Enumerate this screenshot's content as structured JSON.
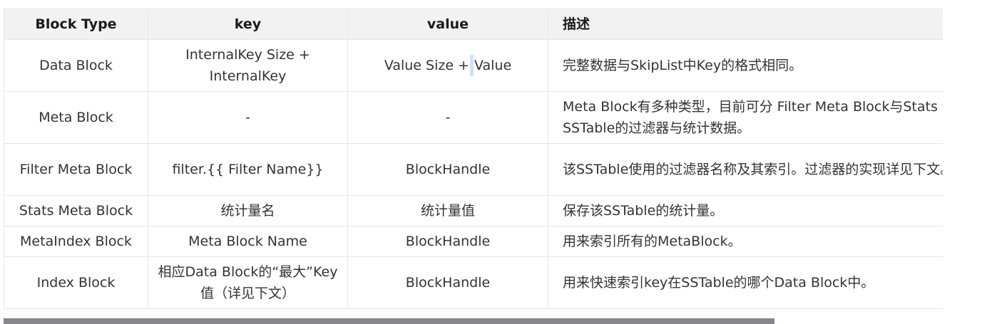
{
  "table": {
    "headers": [
      "Block Type",
      "key",
      "value",
      "描述"
    ],
    "rows": [
      {
        "type": "Data Block",
        "key": "InternalKey Size + InternalKey",
        "value_a": "Value Size +",
        "value_b": "Value",
        "desc": "完整数据与SkipList中Key的格式相同。"
      },
      {
        "type": "Meta Block",
        "key": "-",
        "value": "-",
        "desc_1": "Meta Block有多种类型，目前可分 Filter Meta Block与Stats Meta Block，分别存储",
        "desc_2": "SSTable的过滤器与统计数据。"
      },
      {
        "type": "Filter Meta Block",
        "key": "filter.{{ Filter Name}}",
        "value": "BlockHandle",
        "desc": "该SSTable使用的过滤器名称及其索引。过滤器的实现详见下文。"
      },
      {
        "type": "Stats Meta Block",
        "key": "统计量名",
        "value": "统计量值",
        "desc": "保存该SSTable的统计量。"
      },
      {
        "type": "MetaIndex Block",
        "key": "Meta Block Name",
        "value": "BlockHandle",
        "desc": "用来索引所有的MetaBlock。"
      },
      {
        "type": "Index Block",
        "key": "相应Data Block的“最大”Key值（详见下文）",
        "value": "BlockHandle",
        "desc": "用来快速索引key在SSTable的哪个Data Block中。"
      }
    ]
  }
}
